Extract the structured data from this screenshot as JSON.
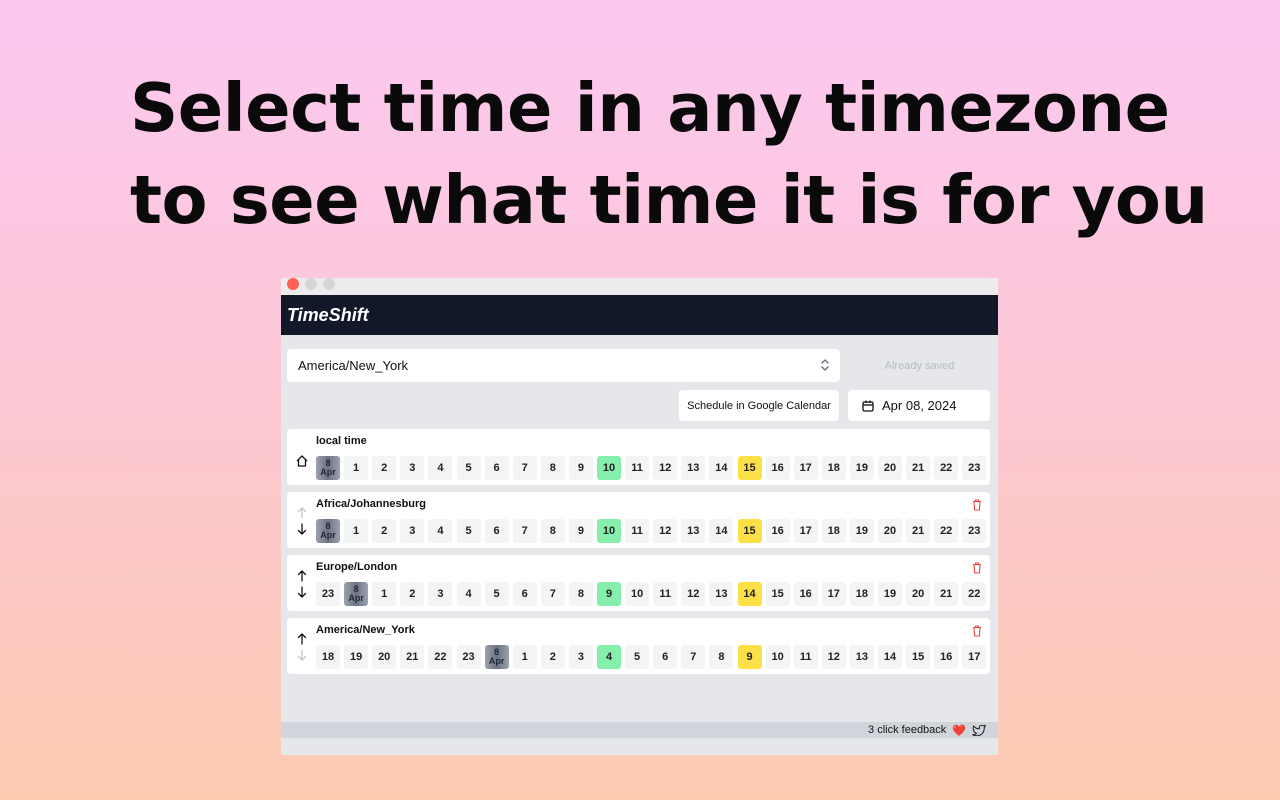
{
  "headline": {
    "line1": "Select time in any timezone",
    "line2": "to see what time it is for you"
  },
  "app": {
    "brand": "TimeShift",
    "timezone_select": {
      "value": "America/New_York"
    },
    "saved_button": "Already saved",
    "gcal_button": "Schedule in Google Calendar",
    "date_button": "Apr 08, 2024",
    "footer": {
      "feedback": "3 click feedback",
      "heart": "❤️"
    }
  },
  "colors": {
    "green": "#86efac",
    "yellow": "#fde047",
    "appbar": "#111827",
    "trash": "#ef4444"
  },
  "zones": [
    {
      "name": "local time",
      "icon": "home-icon",
      "hours": [
        "DATE",
        "1",
        "2",
        "3",
        "4",
        "5",
        "6",
        "7",
        "8",
        "9",
        "10",
        "11",
        "12",
        "13",
        "14",
        "15",
        "16",
        "17",
        "18",
        "19",
        "20",
        "21",
        "22",
        "23"
      ],
      "green": "10",
      "yellow": "15",
      "deletable": false
    },
    {
      "name": "Africa/Johannesburg",
      "icon": "move-arrows-icon",
      "hours": [
        "DATE",
        "1",
        "2",
        "3",
        "4",
        "5",
        "6",
        "7",
        "8",
        "9",
        "10",
        "11",
        "12",
        "13",
        "14",
        "15",
        "16",
        "17",
        "18",
        "19",
        "20",
        "21",
        "22",
        "23"
      ],
      "green": "10",
      "yellow": "15",
      "deletable": true
    },
    {
      "name": "Europe/London",
      "icon": "move-arrows-icon",
      "hours": [
        "23",
        "DATE",
        "1",
        "2",
        "3",
        "4",
        "5",
        "6",
        "7",
        "8",
        "9",
        "10",
        "11",
        "12",
        "13",
        "14",
        "15",
        "16",
        "17",
        "18",
        "19",
        "20",
        "21",
        "22"
      ],
      "green": "9",
      "yellow": "14",
      "deletable": true
    },
    {
      "name": "America/New_York",
      "icon": "move-arrows-icon",
      "hours": [
        "18",
        "19",
        "20",
        "21",
        "22",
        "23",
        "DATE",
        "1",
        "2",
        "3",
        "4",
        "5",
        "6",
        "7",
        "8",
        "9",
        "10",
        "11",
        "12",
        "13",
        "14",
        "15",
        "16",
        "17"
      ],
      "green": "4",
      "yellow": "9",
      "deletable": true
    }
  ],
  "date_cell": {
    "day": "8",
    "month": "Apr"
  }
}
